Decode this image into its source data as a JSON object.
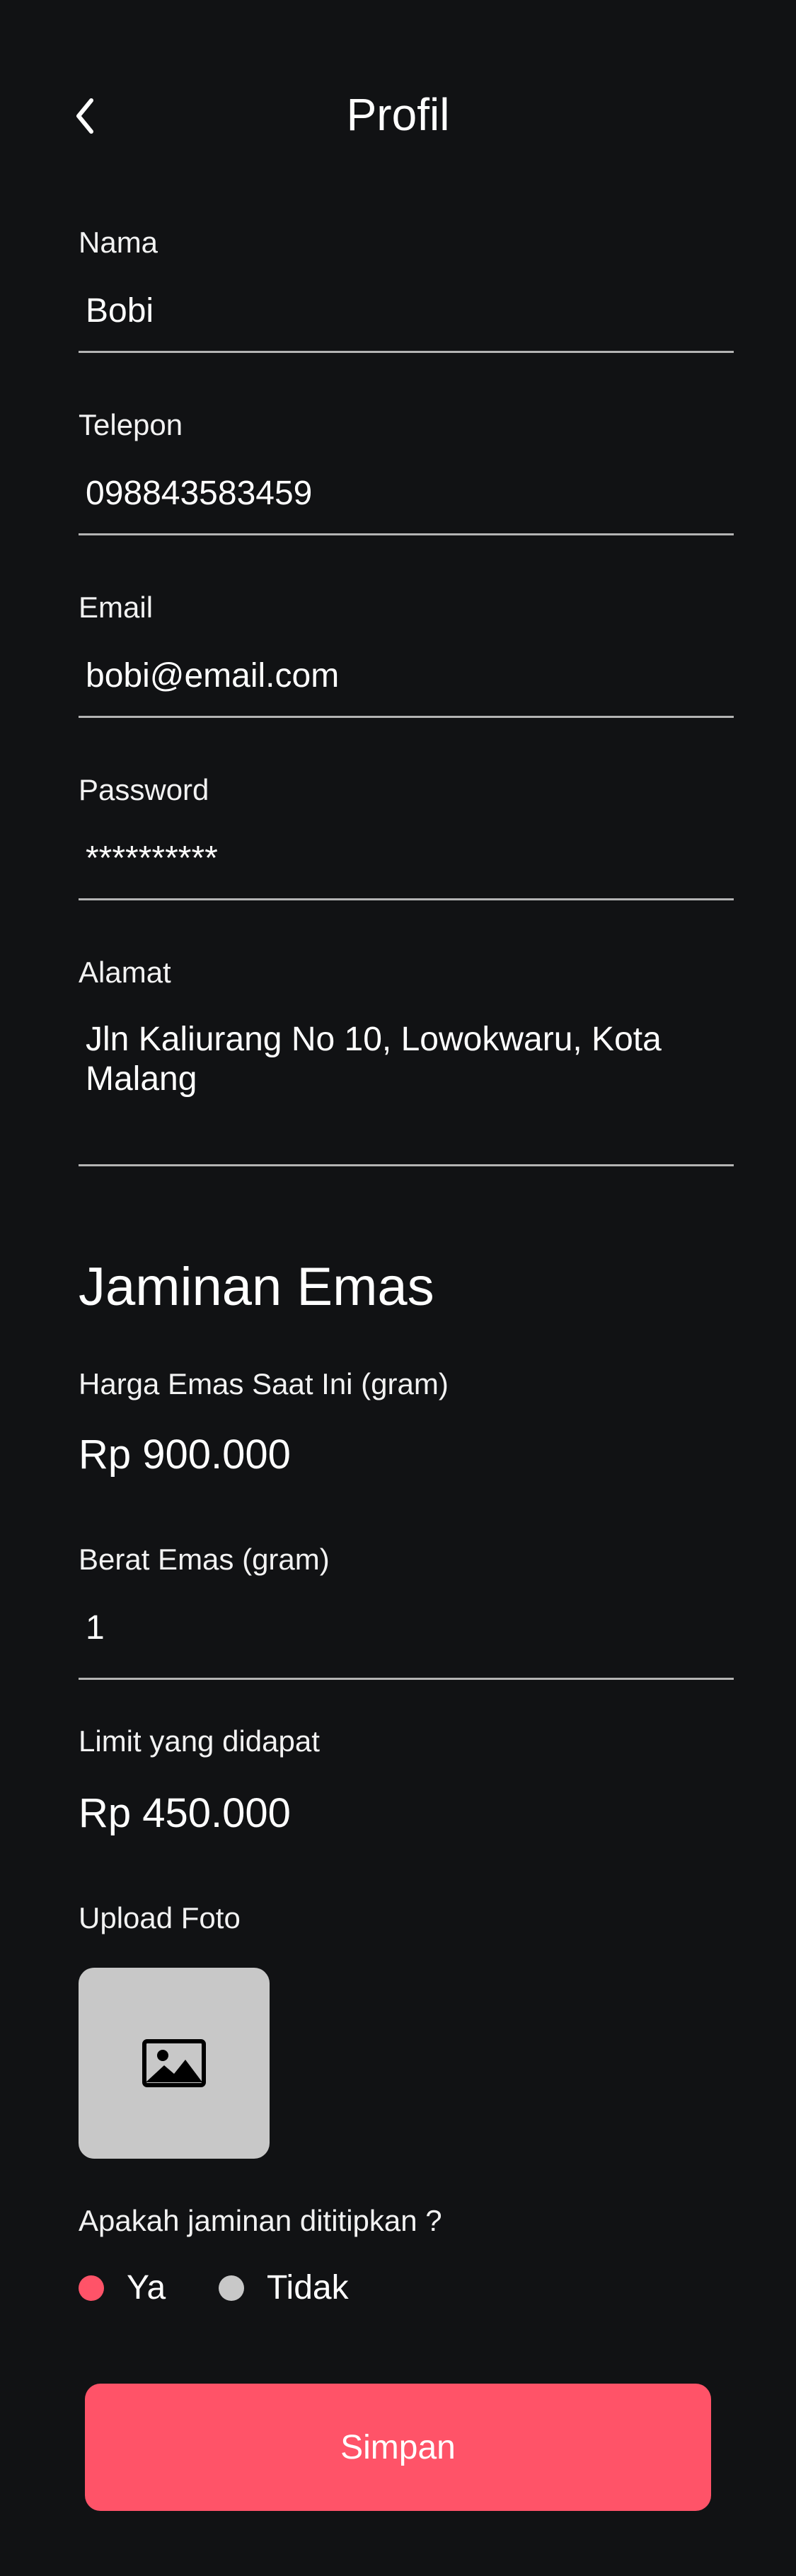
{
  "header": {
    "title": "Profil",
    "back_icon": "chevron-left-icon"
  },
  "fields": {
    "nama": {
      "label": "Nama",
      "value": "Bobi"
    },
    "telepon": {
      "label": "Telepon",
      "value": "098843583459"
    },
    "email": {
      "label": "Email",
      "value": "bobi@email.com"
    },
    "password": {
      "label": "Password",
      "value": "**********"
    },
    "alamat": {
      "label": "Alamat",
      "value": "Jln Kaliurang No 10, Lowokwaru, Kota Malang"
    }
  },
  "jaminan": {
    "title": "Jaminan Emas",
    "harga_label": "Harga Emas Saat Ini (gram)",
    "harga_value": "Rp 900.000",
    "berat_label": "Berat Emas (gram)",
    "berat_value": "1",
    "limit_label": "Limit yang didapat",
    "limit_value": "Rp 450.000",
    "upload_label": "Upload Foto",
    "upload_icon": "image-icon",
    "question": "Apakah jaminan dititipkan ?",
    "options": [
      {
        "label": "Ya",
        "selected": true
      },
      {
        "label": "Tidak",
        "selected": false
      }
    ]
  },
  "actions": {
    "save_label": "Simpan"
  },
  "colors": {
    "background": "#111214",
    "accent": "#ff5368",
    "radio_unselected": "#c8c8c8",
    "upload_bg": "#c8c8c8",
    "divider": "#b4b4b4"
  }
}
